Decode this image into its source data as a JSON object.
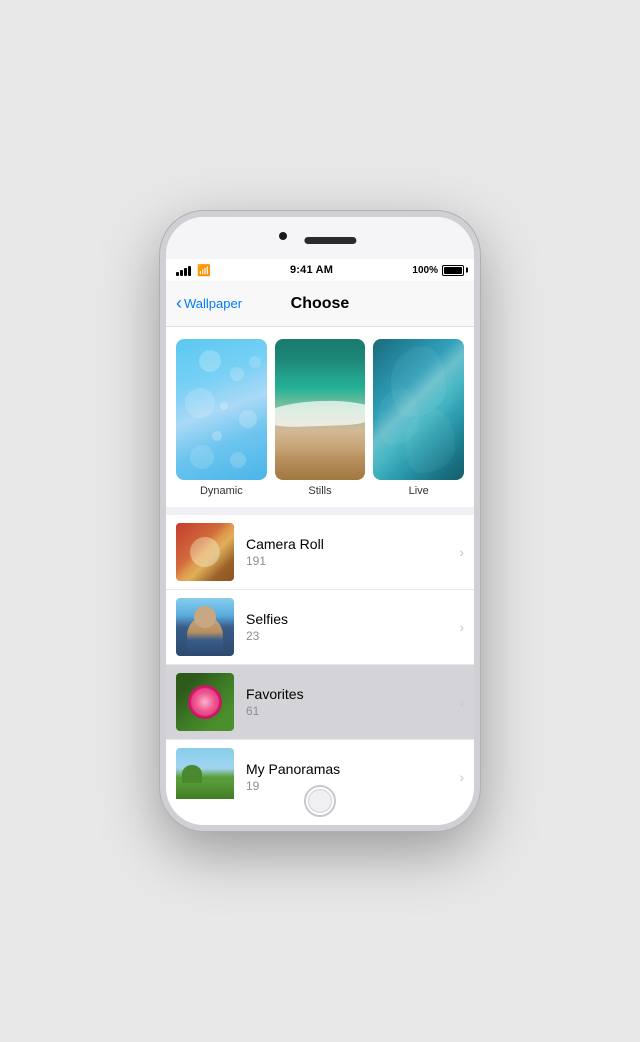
{
  "phone": {
    "status_bar": {
      "time": "9:41 AM",
      "battery_percent": "100%"
    },
    "nav": {
      "back_label": "Wallpaper",
      "title": "Choose"
    },
    "wallpaper_categories": [
      {
        "id": "dynamic",
        "label": "Dynamic"
      },
      {
        "id": "stills",
        "label": "Stills"
      },
      {
        "id": "live",
        "label": "Live"
      }
    ],
    "albums": [
      {
        "id": "camera-roll",
        "name": "Camera Roll",
        "count": "191",
        "highlighted": false
      },
      {
        "id": "selfies",
        "name": "Selfies",
        "count": "23",
        "highlighted": false
      },
      {
        "id": "favorites",
        "name": "Favorites",
        "count": "61",
        "highlighted": true
      },
      {
        "id": "panoramas",
        "name": "My Panoramas",
        "count": "19",
        "highlighted": false
      }
    ]
  }
}
